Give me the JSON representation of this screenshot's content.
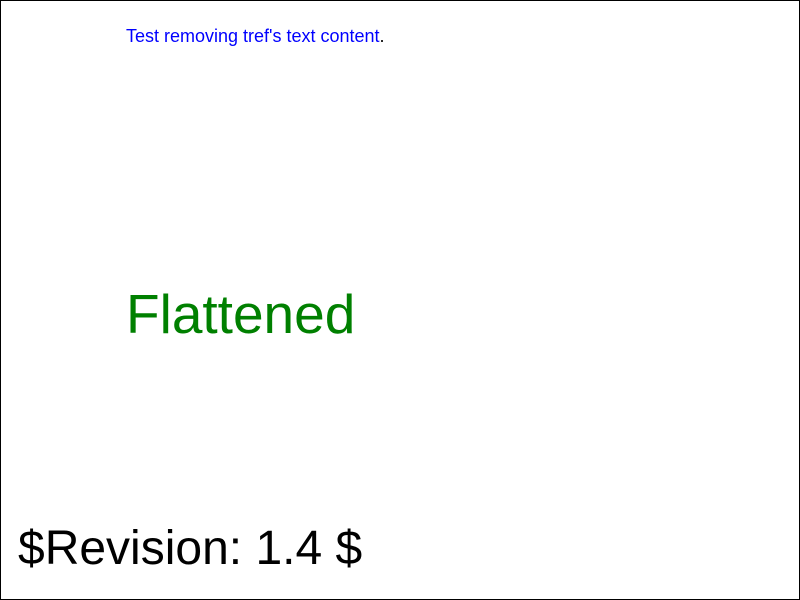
{
  "test": {
    "title": "Test removing tref's text content",
    "title_period": ".",
    "title_color": "#0000ff"
  },
  "content": {
    "flattened_text": "Flattened",
    "flattened_color": "#008000"
  },
  "footer": {
    "revision": "$Revision: 1.4 $",
    "revision_color": "#000000"
  }
}
